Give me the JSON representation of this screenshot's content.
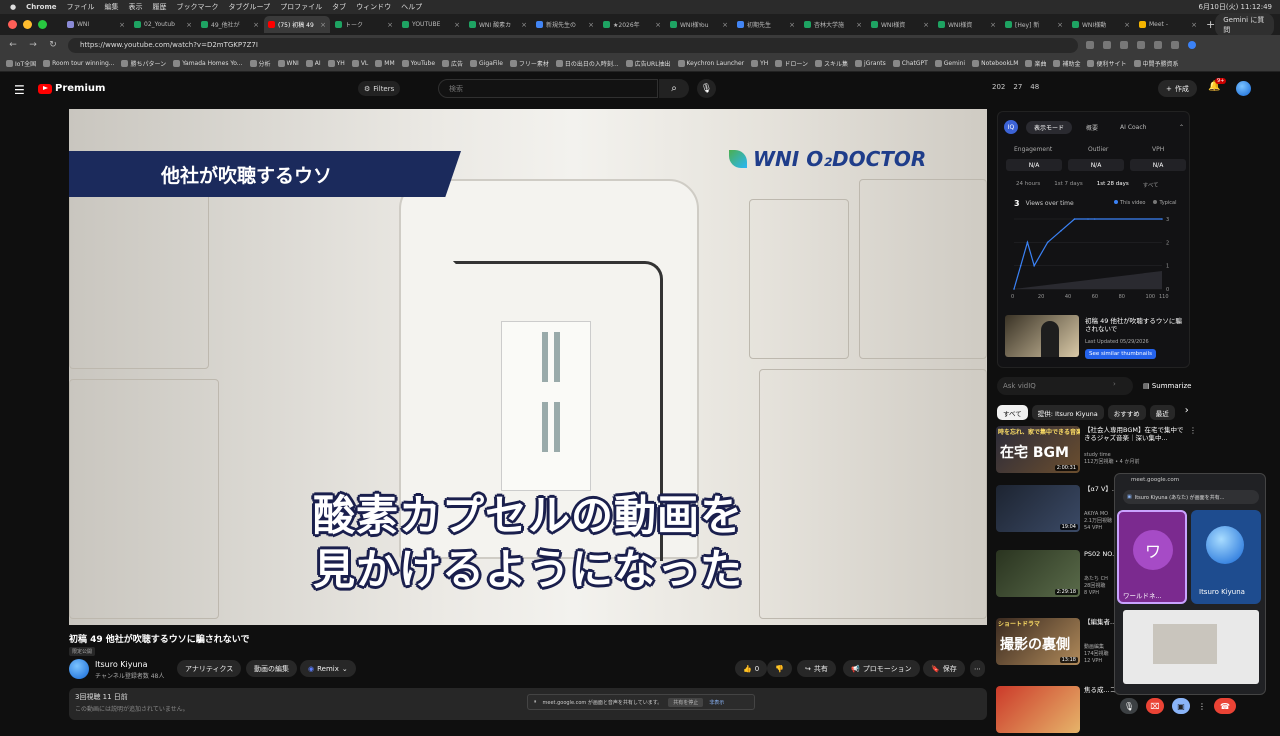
{
  "menubar": {
    "app": "Chrome",
    "items": [
      "ファイル",
      "編集",
      "表示",
      "履歴",
      "ブックマーク",
      "タブグループ",
      "プロファイル",
      "タブ",
      "ウィンドウ",
      "ヘルプ"
    ],
    "clock": "6月10日(火) 11:12:49"
  },
  "tabs": [
    {
      "label": "WNI",
      "color": "#8a8ad6",
      "active": false
    },
    {
      "label": "02_Youtub",
      "color": "#1ea362",
      "active": false
    },
    {
      "label": "49_他社が",
      "color": "#1ea362",
      "active": false
    },
    {
      "label": "(75) 初稿 49",
      "color": "#ff0000",
      "active": true
    },
    {
      "label": "トーク",
      "color": "#1ea362",
      "active": false
    },
    {
      "label": "YOUTUBE",
      "color": "#1ea362",
      "active": false
    },
    {
      "label": "WNI 酸素カ",
      "color": "#1ea362",
      "active": false
    },
    {
      "label": "新規先生の",
      "color": "#4285f4",
      "active": false
    },
    {
      "label": "★2026年",
      "color": "#1ea362",
      "active": false
    },
    {
      "label": "WNI様You",
      "color": "#1ea362",
      "active": false
    },
    {
      "label": "初期先生",
      "color": "#4285f4",
      "active": false
    },
    {
      "label": "杏林大学施",
      "color": "#1ea362",
      "active": false
    },
    {
      "label": "WNI様資",
      "color": "#1ea362",
      "active": false
    },
    {
      "label": "WNI様資",
      "color": "#1ea362",
      "active": false
    },
    {
      "label": "[Hey] 新",
      "color": "#1ea362",
      "active": false
    },
    {
      "label": "WNI様動",
      "color": "#1ea362",
      "active": false
    },
    {
      "label": "Meet -",
      "color": "#f4b400",
      "active": false
    }
  ],
  "gemini_button": "Gemini に質問",
  "url": "https://www.youtube.com/watch?v=D2mTGKP7Z7I",
  "bookmarks": [
    "IoT全国",
    "Room tour winning...",
    "勝ちパターン",
    "Yamada Homes Yo...",
    "分析",
    "WNI",
    "AI",
    "YH",
    "VL",
    "MM",
    "YouTube",
    "広告",
    "GigaFile",
    "フリー素材",
    "日の出日の入時刻...",
    "広告URL抽出",
    "Keychron Launcher",
    "YH",
    "ドローン",
    "スキル集",
    "jGrants",
    "ChatGPT",
    "Gemini",
    "NotebookLM",
    "楽曲",
    "補助金",
    "便利サイト",
    "中間予勝資系"
  ],
  "yt": {
    "logo": "Premium",
    "filters": "Filters",
    "search_placeholder": "検索",
    "stats": [
      "202",
      "27",
      "48"
    ],
    "create": "作成",
    "notif": "9+"
  },
  "video": {
    "banner_text": "他社が吹聴するウソ",
    "brand": "WNI O₂DOCTOR",
    "caption_line1": "酸素カプセルの動画を",
    "caption_line2": "見かけるようになった",
    "title": "初稿 49 他社が吹聴するウソに騙されないで",
    "visibility": "限定公開",
    "channel": "Itsuro Kiyuna",
    "subs": "チャンネル登録者数 48人",
    "btn_analytics": "アナリティクス",
    "btn_edit": "動画の編集",
    "btn_remix": "Remix",
    "likes": "0",
    "btn_share": "共有",
    "btn_promote": "プロモーション",
    "btn_save": "保存",
    "views_date": "3回視聴  11 日前",
    "desc": "この動画には説明が追加されていません。"
  },
  "share_banner": {
    "text": "meet.google.com が画面と音声を共有しています。",
    "stop": "共有を停止",
    "hide": "非表示"
  },
  "vidiq": {
    "modes": [
      "表示モード",
      "概要",
      "AI Coach"
    ],
    "metrics": [
      {
        "label": "Engagement",
        "value": "N/A"
      },
      {
        "label": "Outlier",
        "value": "N/A"
      },
      {
        "label": "VPH",
        "value": "N/A"
      }
    ],
    "ranges": [
      "24 hours",
      "1st 7 days",
      "1st 28 days",
      "すべて"
    ],
    "views_num": "3",
    "views_label": "Views over time",
    "legend_this": "This video",
    "legend_typical": "Typical",
    "thumb_title": "初稿 49 他社が吹聴するウソに騙されないで",
    "thumb_updated": "Last Updated 05/29/2026",
    "similar": "See similar thumbnails",
    "ask": "Ask vidIQ",
    "summarize": "Summarize"
  },
  "chart_data": {
    "type": "line",
    "x": [
      0,
      5,
      10,
      15,
      25,
      35,
      45,
      55,
      60,
      110
    ],
    "y": [
      0,
      1,
      2,
      1,
      2,
      2.5,
      3,
      3,
      3,
      3
    ],
    "xticks": [
      "0",
      "20",
      "40",
      "60",
      "80",
      "100",
      "110"
    ],
    "yticks": [
      "0",
      "1",
      "2",
      "3"
    ],
    "xlim": [
      0,
      110
    ],
    "ylim": [
      0,
      3
    ]
  },
  "chips": [
    "すべて",
    "提供: Itsuro Kiyuna",
    "おすすめ",
    "最近"
  ],
  "recs": [
    {
      "title": "【社会人専用BGM】在宅で集中できるジャズ音楽｜深い集中...",
      "meta": "study time\n112万回視聴 • 4 か月前",
      "dur": "2:00:31",
      "vph": "",
      "c1": "#2b2b3a",
      "c2": "#6b4e2e",
      "overlay": "在宅 BGM",
      "kicker": "時を忘れ、家で集中できる音楽"
    },
    {
      "title": "【α7 V】...入 発表...",
      "meta": "AKIYA MO\n2.1万回視聴",
      "dur": "19:04",
      "vph": "54 VPH",
      "c1": "#1d2431",
      "c2": "#3b4a66",
      "overlay": "",
      "kicker": ""
    },
    {
      "title": "PS02 NO...いから！",
      "meta": "あたち CH\n28回視聴",
      "dur": "2:29:18",
      "vph": "8 VPH",
      "c1": "#2a3420",
      "c2": "#5a6b4a",
      "overlay": "",
      "kicker": ""
    },
    {
      "title": "【編集者...マってる...",
      "meta": "動画編集\n174回視聴",
      "dur": "13:18",
      "vph": "12 VPH",
      "c1": "#3a2a20",
      "c2": "#b08a5a",
      "overlay": "撮影の裏側",
      "kicker": "ショートドラマ"
    },
    {
      "title": "焦る成...コメミ...",
      "meta": "",
      "dur": "",
      "vph": "",
      "c1": "#cc3a2a",
      "c2": "#e6b46a",
      "overlay": "",
      "kicker": ""
    }
  ],
  "meet": {
    "url": "meet.google.com",
    "share": "Itsuro Kiyuna (あなた) が画面を共有...",
    "p1_initial": "ワ",
    "p1_name": "ワールドネ...",
    "p2_name": "Itsuro Kiyuna"
  }
}
